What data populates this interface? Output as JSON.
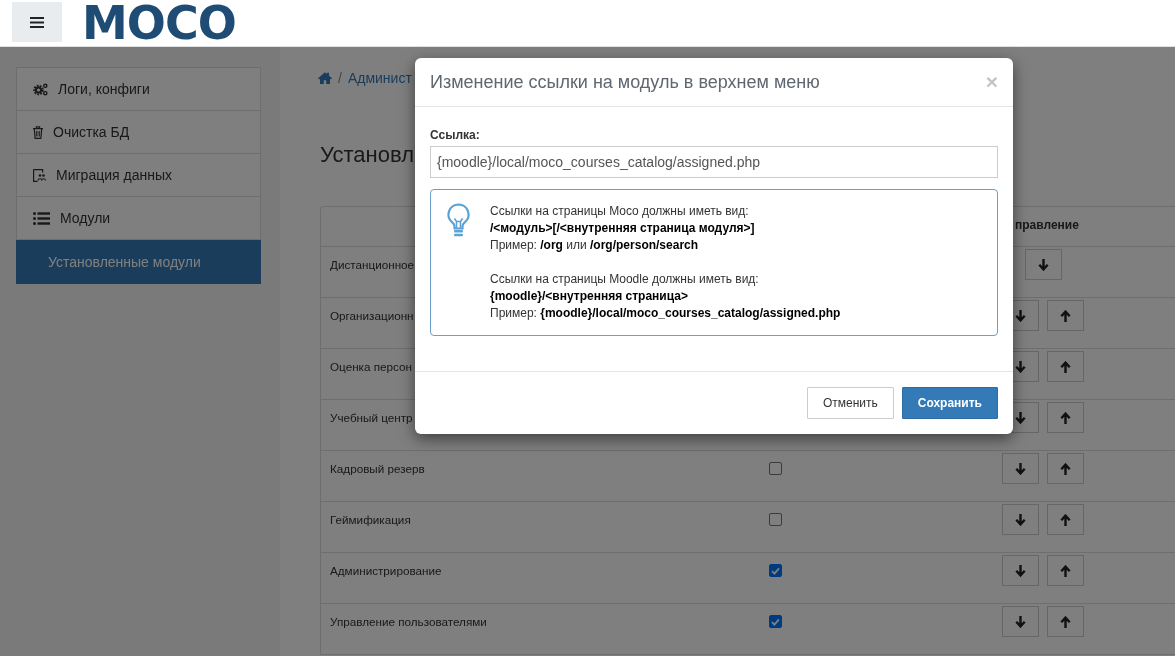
{
  "header": {
    "logo": "MOCO"
  },
  "sidebar": {
    "items": [
      {
        "label": "Логи, конфиги",
        "selected": false
      },
      {
        "label": "Очистка БД",
        "selected": false
      },
      {
        "label": "Миграция данных",
        "selected": false
      },
      {
        "label": "Модули",
        "selected": false,
        "children": [
          {
            "label": "Установленные модули",
            "selected": true
          }
        ]
      }
    ]
  },
  "breadcrumb": {
    "separator": "/",
    "items": [
      "Админист"
    ]
  },
  "page_title": "Установл",
  "table": {
    "column_3": "правление",
    "rows": [
      {
        "name": "Дистанционное",
        "can_move_down": true,
        "can_move_up": false
      },
      {
        "name": "Организационн",
        "can_move_down": true,
        "can_move_up": true
      },
      {
        "name": "Оценка персон",
        "can_move_down": true,
        "can_move_up": true
      },
      {
        "name": "Учебный центр",
        "can_move_down": true,
        "can_move_up": true
      },
      {
        "name": "Кадровый резерв",
        "checked": false,
        "can_move_down": true,
        "can_move_up": true
      },
      {
        "name": "Геймификация",
        "checked": false,
        "can_move_down": true,
        "can_move_up": true
      },
      {
        "name": "Администрирование",
        "checked": true,
        "can_move_down": true,
        "can_move_up": true
      },
      {
        "name": "Управление пользователями",
        "checked": true,
        "can_move_down": true,
        "can_move_up": true
      }
    ]
  },
  "modal": {
    "title": "Изменение ссылки на модуль в верхнем меню",
    "close": "×",
    "field": {
      "label": "Ссылка:",
      "value": "{moodle}/local/moco_courses_catalog/assigned.php"
    },
    "hint": {
      "blocks": [
        {
          "intro": "Ссылки на страницы Moco должны иметь вид:",
          "pattern": "/<модуль>[/<внутренняя страница модуля>]",
          "example": "Пример: **/org** или **/org/person/search**"
        },
        {
          "intro": "Ссылки на страницы Moodle должны иметь вид:",
          "pattern": "{moodle}/<внутренняя страница>",
          "example": "Пример: **{moodle}/local/moco_courses_catalog/assigned.php**"
        }
      ]
    },
    "buttons": [
      {
        "label": "Отменить",
        "kind": "secondary"
      },
      {
        "label": "Сохранить",
        "kind": "primary"
      }
    ]
  }
}
